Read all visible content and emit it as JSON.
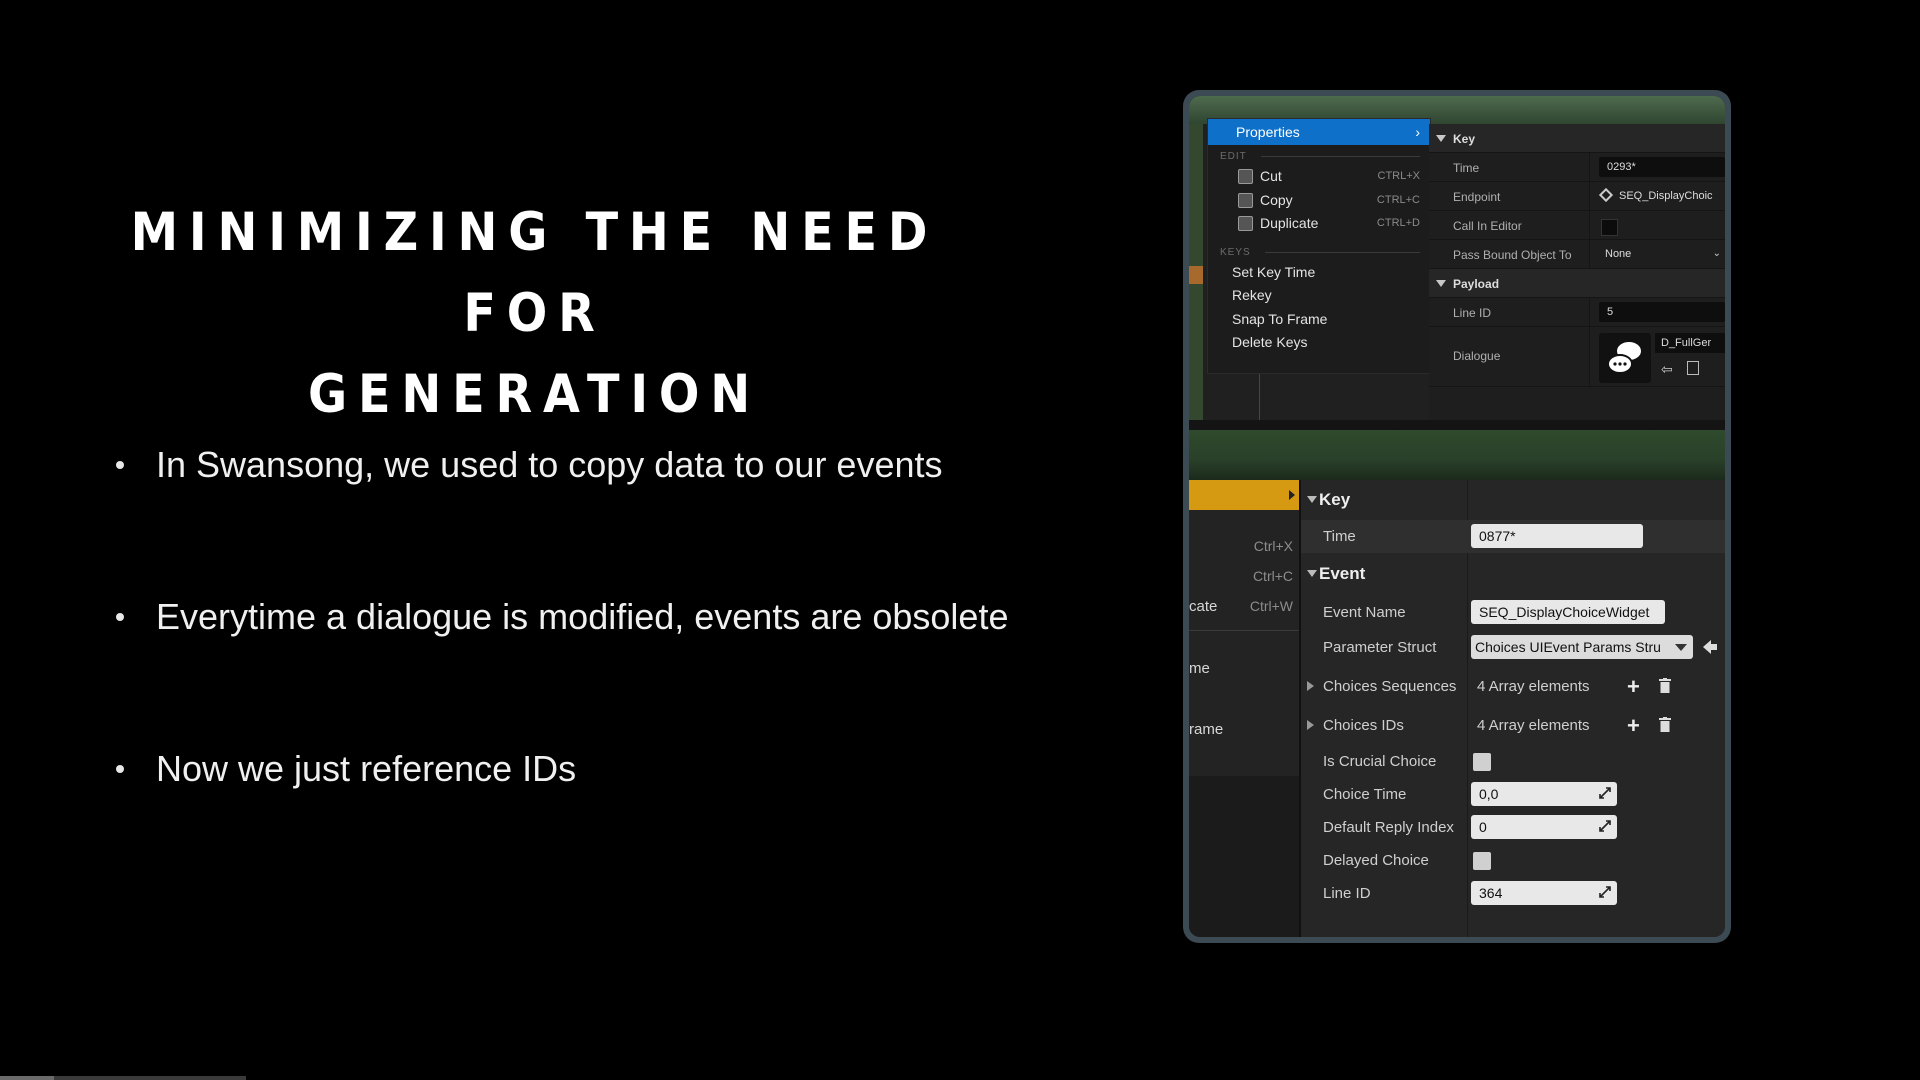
{
  "slide": {
    "title_line1": "MINIMIZING THE NEED FOR",
    "title_line2": "GENERATION",
    "bullets": [
      "In Swansong, we used to copy data to our events",
      "Everytime a dialogue is modified, events are obsolete",
      "Now we just reference IDs"
    ],
    "progress_fraction": 0.22
  },
  "top_editor": {
    "context_menu": {
      "header": "Properties",
      "section_edit": "EDIT",
      "section_keys": "KEYS",
      "items": [
        {
          "label": "Cut",
          "shortcut": "CTRL+X",
          "icon": "cut-icon"
        },
        {
          "label": "Copy",
          "shortcut": "CTRL+C",
          "icon": "copy-icon"
        },
        {
          "label": "Duplicate",
          "shortcut": "CTRL+D",
          "icon": "duplicate-icon"
        }
      ],
      "key_items": [
        "Set Key Time",
        "Rekey",
        "Snap To Frame",
        "Delete Keys"
      ]
    },
    "properties": {
      "key_category": "Key",
      "time_label": "Time",
      "time_value": "0293*",
      "endpoint_label": "Endpoint",
      "endpoint_value": "SEQ_DisplayChoic",
      "call_in_editor_label": "Call In Editor",
      "pass_bound_label": "Pass Bound Object To",
      "pass_bound_value": "None",
      "payload_category": "Payload",
      "line_id_label": "Line ID",
      "line_id_value": "5",
      "dialogue_label": "Dialogue",
      "dialogue_value": "D_FullGer"
    }
  },
  "bottom_editor": {
    "left_menu": {
      "cut_shortcut": "Ctrl+X",
      "copy_shortcut": "Ctrl+C",
      "dup_fragment": "cate",
      "dup_shortcut": "Ctrl+W",
      "me_fragment": "me",
      "rame_fragment": "rame"
    },
    "properties": {
      "key_category": "Key",
      "time_label": "Time",
      "time_value": "0877*",
      "event_category": "Event",
      "event_name_label": "Event Name",
      "event_name_value": "SEQ_DisplayChoiceWidget",
      "parameter_struct_label": "Parameter Struct",
      "parameter_struct_value": "Choices UIEvent Params Stru",
      "choices_sequences_label": "Choices Sequences",
      "choices_sequences_value": "4 Array elements",
      "choices_ids_label": "Choices IDs",
      "choices_ids_value": "4 Array elements",
      "is_crucial_label": "Is Crucial Choice",
      "choice_time_label": "Choice Time",
      "choice_time_value": "0,0",
      "default_reply_label": "Default Reply Index",
      "default_reply_value": "0",
      "delayed_choice_label": "Delayed Choice",
      "line_id_label": "Line ID",
      "line_id_value": "364"
    }
  },
  "colors": {
    "menu_highlight": "#0e70c8",
    "selected_track": "#d69a12",
    "timeline_green": "#2f4a2c"
  }
}
